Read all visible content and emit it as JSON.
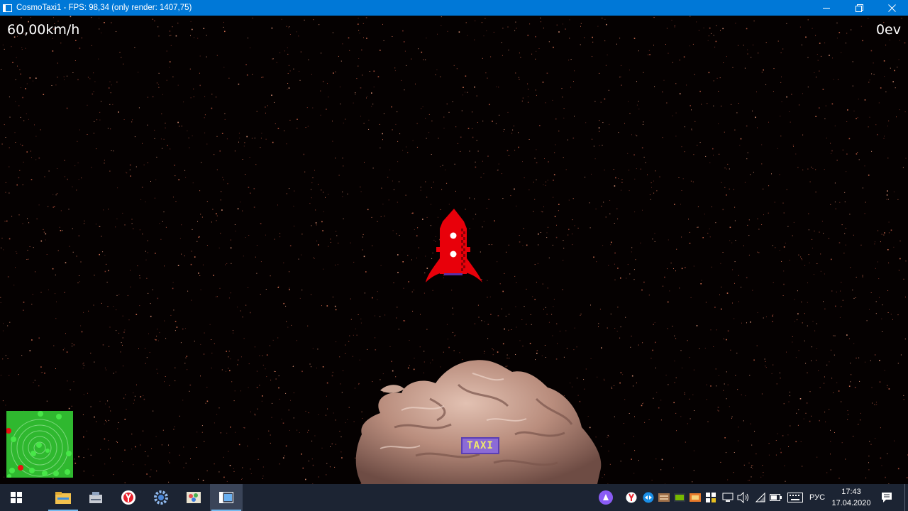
{
  "window": {
    "title": "CosmoTaxi1 - FPS: 98,34 (only render: 1407,75)",
    "icons": [
      "app-window-icon",
      "minimize-icon",
      "restore-icon",
      "close-icon"
    ]
  },
  "hud": {
    "speed": "60,00km/h",
    "money": "0ev"
  },
  "game": {
    "taxi_sign": "TAXI",
    "icons": [
      "rocket-ship",
      "asteroid",
      "minimap-radar"
    ]
  },
  "taskbar": {
    "pinned": [
      "windows-start-icon",
      "file-explorer-icon",
      "disk-cleanup-icon",
      "yandex-browser-icon",
      "settings-gear-icon",
      "paint-icon",
      "cosmotaxi-app-icon"
    ],
    "tray": [
      "alice-assistant-icon",
      "yandex-icon",
      "teamviewer-icon",
      "hardware-icon",
      "nvidia-icon",
      "display-icon",
      "security-shield-icon",
      "device-icon",
      "volume-icon",
      "wifi-icon",
      "battery-icon",
      "keyboard-icon"
    ],
    "language": "РУС",
    "time": "17:43",
    "date": "17.04.2020",
    "colors": {
      "taskbar_bg": "#1c2433",
      "titlebar_bg": "#0078d7",
      "rocket_red": "#e8000a",
      "minimap_green": "#2fb82f"
    }
  }
}
